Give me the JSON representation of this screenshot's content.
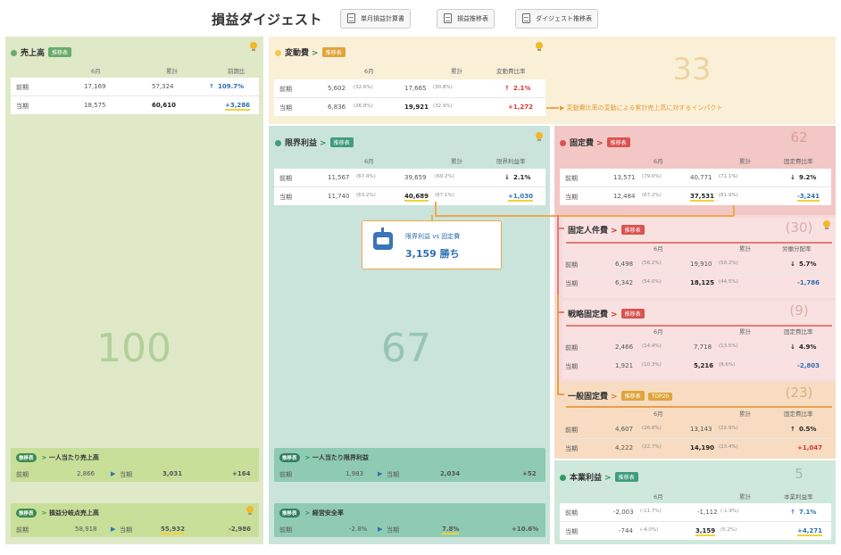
{
  "header": {
    "title": "損益ダイジェスト",
    "buttons": [
      "単月損益計算書",
      "損益推移表",
      "ダイジェスト推移表"
    ]
  },
  "colors": {
    "green": "#dfe9c8",
    "orange": "#faf0d8",
    "teal": "#cae4dc",
    "red": "#f6dada",
    "accent_blue": "#2d6fb5",
    "accent_red": "#d9342b"
  },
  "col_headers": {
    "month": "6月",
    "cumulative": "累計",
    "yoy": "前期比",
    "var_ratio": "変動費比率",
    "marginal_ratio": "限界利益率",
    "fixed_ratio": "固定費比率",
    "labor_share": "労働分配率",
    "op_ratio": "本業利益率"
  },
  "sales": {
    "title": "売上高",
    "tag": "推移表",
    "big": "100",
    "rows": [
      {
        "label": "前期",
        "month": "17,169",
        "cum": "57,324",
        "arrow": "↑",
        "diff": "109.7%"
      },
      {
        "label": "当期",
        "month": "18,575",
        "cum": "60,610",
        "diff": "+3,286"
      }
    ]
  },
  "variable": {
    "title": "変動費",
    "tag": "推移表",
    "big": "33",
    "rows": [
      {
        "label": "前期",
        "month": "5,602",
        "month_pct": "(32.6%)",
        "cum": "17,665",
        "cum_pct": "(30.8%)",
        "arrow": "↑",
        "diff": "2.1%"
      },
      {
        "label": "当期",
        "month": "6,836",
        "month_pct": "(36.8%)",
        "cum": "19,921",
        "cum_pct": "(32.9%)",
        "diff": "+1,272"
      }
    ],
    "note": "変動費比率の変動による累計売上高に対するインパクト"
  },
  "marginal": {
    "title": "限界利益",
    "tag": "推移表",
    "big": "67",
    "rows": [
      {
        "label": "前期",
        "month": "11,567",
        "month_pct": "(67.4%)",
        "cum": "39,659",
        "cum_pct": "(69.2%)",
        "arrow": "↓",
        "diff": "2.1%"
      },
      {
        "label": "当期",
        "month": "11,740",
        "month_pct": "(63.2%)",
        "cum": "40,689",
        "cum_pct": "(67.1%)",
        "diff": "+1,030"
      }
    ]
  },
  "callout": {
    "label": "限界利益 vs 固定費",
    "value": "3,159 勝ち"
  },
  "fixed": {
    "title": "固定費",
    "tag": "推移表",
    "big": "62",
    "rows": [
      {
        "label": "前期",
        "month": "13,571",
        "month_pct": "(79.0%)",
        "cum": "40,771",
        "cum_pct": "(71.1%)",
        "arrow": "↓",
        "diff": "9.2%"
      },
      {
        "label": "当期",
        "month": "12,484",
        "month_pct": "(67.2%)",
        "cum": "37,531",
        "cum_pct": "(61.9%)",
        "diff": "-3,241"
      }
    ]
  },
  "labor": {
    "title": "固定人件費",
    "tag": "推移表",
    "big": "(30)",
    "rows": [
      {
        "label": "前期",
        "month": "6,498",
        "month_pct": "(56.2%)",
        "cum": "19,910",
        "cum_pct": "(50.2%)",
        "arrow": "↓",
        "diff": "5.7%"
      },
      {
        "label": "当期",
        "month": "6,342",
        "month_pct": "(54.0%)",
        "cum": "18,125",
        "cum_pct": "(44.5%)",
        "diff": "-1,786"
      }
    ]
  },
  "strategic": {
    "title": "戦略固定費",
    "tag": "推移表",
    "big": "(9)",
    "rows": [
      {
        "label": "前期",
        "month": "2,466",
        "month_pct": "(14.4%)",
        "cum": "7,718",
        "cum_pct": "(13.5%)",
        "arrow": "↓",
        "diff": "4.9%"
      },
      {
        "label": "当期",
        "month": "1,921",
        "month_pct": "(10.3%)",
        "cum": "5,216",
        "cum_pct": "(8.6%)",
        "diff": "-2,803"
      }
    ]
  },
  "general": {
    "title": "一般固定費",
    "tag": "推移表",
    "tag2": "TOP20",
    "big": "(23)",
    "rows": [
      {
        "label": "前期",
        "month": "4,607",
        "month_pct": "(26.8%)",
        "cum": "13,143",
        "cum_pct": "(22.9%)",
        "arrow": "↑",
        "diff": "0.5%"
      },
      {
        "label": "当期",
        "month": "4,222",
        "month_pct": "(22.7%)",
        "cum": "14,190",
        "cum_pct": "(23.4%)",
        "diff": "+1,047"
      }
    ]
  },
  "operating": {
    "title": "本業利益",
    "tag": "推移表",
    "big": "5",
    "rows": [
      {
        "label": "前期",
        "month": "-2,003",
        "month_pct": "(-11.7%)",
        "cum": "-1,112",
        "cum_pct": "(-1.9%)",
        "arrow": "↑",
        "diff": "7.1%"
      },
      {
        "label": "当期",
        "month": "-744",
        "month_pct": "(-4.0%)",
        "cum": "3,159",
        "cum_pct": "(5.2%)",
        "diff": "+4,271"
      }
    ]
  },
  "mini": {
    "sales_per_person": {
      "pill": "推移表",
      "title": "一人当たり売上高",
      "prev_label": "前期",
      "prev": "2,866",
      "cur_label": "当期",
      "cur": "3,031",
      "diff": "+164"
    },
    "sales_excl": {
      "pill": "推移表",
      "title": "損益分岐点売上高",
      "prev_label": "前期",
      "prev": "58,918",
      "cur_label": "当期",
      "cur": "55,932",
      "diff": "-2,986"
    },
    "marginal_per_person": {
      "pill": "推移表",
      "title": "一人当たり限界利益",
      "prev_label": "前期",
      "prev": "1,983",
      "cur_label": "当期",
      "cur": "2,034",
      "diff": "+52"
    },
    "safety": {
      "pill": "推移表",
      "title": "経営安全率",
      "prev_label": "前期",
      "prev": "-2.8%",
      "cur_label": "当期",
      "cur": "7.8%",
      "diff": "+10.6%"
    }
  }
}
